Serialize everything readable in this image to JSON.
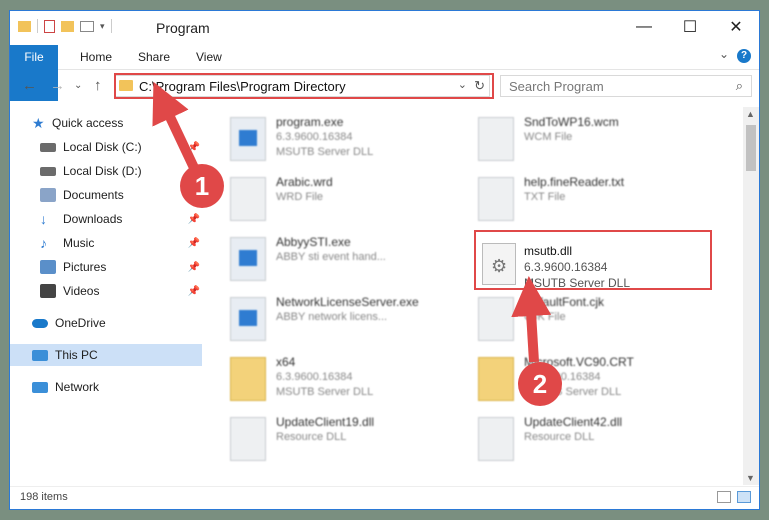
{
  "window": {
    "title": "Program",
    "minimize_glyph": "—",
    "maximize_glyph": "☐",
    "close_glyph": "✕"
  },
  "ribbon": {
    "tabs": [
      "File",
      "Home",
      "Share",
      "View"
    ],
    "help_glyph": "?",
    "expand_glyph": "⌄"
  },
  "nav": {
    "back_glyph": "←",
    "forward_glyph": "→",
    "recent_glyph": "⌄",
    "up_glyph": "↑",
    "address_path": "C:\\Program Files\\Program Directory",
    "address_dropdown_glyph": "⌄",
    "refresh_glyph": "↻",
    "search_placeholder": "Search Program",
    "search_glyph": "⌕"
  },
  "sidebar": {
    "pin_glyph": "📌",
    "items": [
      {
        "label": "Quick access",
        "icon": "star-icon",
        "color": "#2f7cd1",
        "pinned": false
      },
      {
        "label": "Local Disk (C:)",
        "icon": "drive-icon",
        "color": "#6b6b6b",
        "pinned": true
      },
      {
        "label": "Local Disk (D:)",
        "icon": "drive-icon",
        "color": "#6b6b6b",
        "pinned": true
      },
      {
        "label": "Documents",
        "icon": "documents-icon",
        "color": "#8aa4c8",
        "pinned": true
      },
      {
        "label": "Downloads",
        "icon": "download-icon",
        "color": "#2f7cd1",
        "pinned": true
      },
      {
        "label": "Music",
        "icon": "music-icon",
        "color": "#2f7cd1",
        "pinned": true
      },
      {
        "label": "Pictures",
        "icon": "pictures-icon",
        "color": "#5a8fc9",
        "pinned": true
      },
      {
        "label": "Videos",
        "icon": "videos-icon",
        "color": "#444444",
        "pinned": true
      },
      {
        "label": "OneDrive",
        "icon": "cloud-icon",
        "color": "#1979ca",
        "pinned": false
      },
      {
        "label": "This PC",
        "icon": "computer-icon",
        "color": "#3b8fd8",
        "pinned": false,
        "selected": true
      },
      {
        "label": "Network",
        "icon": "network-icon",
        "color": "#3b8fd8",
        "pinned": false
      }
    ]
  },
  "files": [
    {
      "name": "program.exe",
      "line2": "6.3.9600.16384",
      "line3": "MSUTB Server DLL",
      "icon": "app-icon"
    },
    {
      "name": "SndToWP16.wcm",
      "line2": "WCM File",
      "line3": "",
      "icon": "file-icon"
    },
    {
      "name": "Arabic.wrd",
      "line2": "WRD File",
      "line3": "",
      "icon": "file-icon"
    },
    {
      "name": "help.fineReader.txt",
      "line2": "TXT File",
      "line3": "",
      "icon": "file-icon"
    },
    {
      "name": "AbbyySTI.exe",
      "line2": "ABBY sti event hand...",
      "line3": "",
      "icon": "app-icon"
    },
    {
      "name": "",
      "line2": "",
      "line3": "",
      "icon": "none"
    },
    {
      "name": "NetworkLicenseServer.exe",
      "line2": "ABBY network licens...",
      "line3": "",
      "icon": "app-icon"
    },
    {
      "name": "DefaultFont.cjk",
      "line2": "CJK File",
      "line3": "",
      "icon": "file-icon"
    },
    {
      "name": "x64",
      "line2": "6.3.9600.16384",
      "line3": "MSUTB Server DLL",
      "icon": "folder-icon"
    },
    {
      "name": "Microsoft.VC90.CRT",
      "line2": "6.3.9600.16384",
      "line3": "MSUTB Server DLL",
      "icon": "folder-icon"
    },
    {
      "name": "UpdateClient19.dll",
      "line2": "Resource DLL",
      "line3": "",
      "icon": "dll-icon"
    },
    {
      "name": "UpdateClient42.dll",
      "line2": "Resource DLL",
      "line3": "",
      "icon": "dll-icon"
    }
  ],
  "highlighted_file": {
    "name": "msutb.dll",
    "line2": "6.3.9600.16384",
    "line3": "MSUTB Server DLL",
    "icon_glyph": "⚙"
  },
  "status": {
    "item_count": "198 items"
  },
  "callouts": {
    "step1": "1",
    "step2": "2",
    "color": "#e04848"
  }
}
